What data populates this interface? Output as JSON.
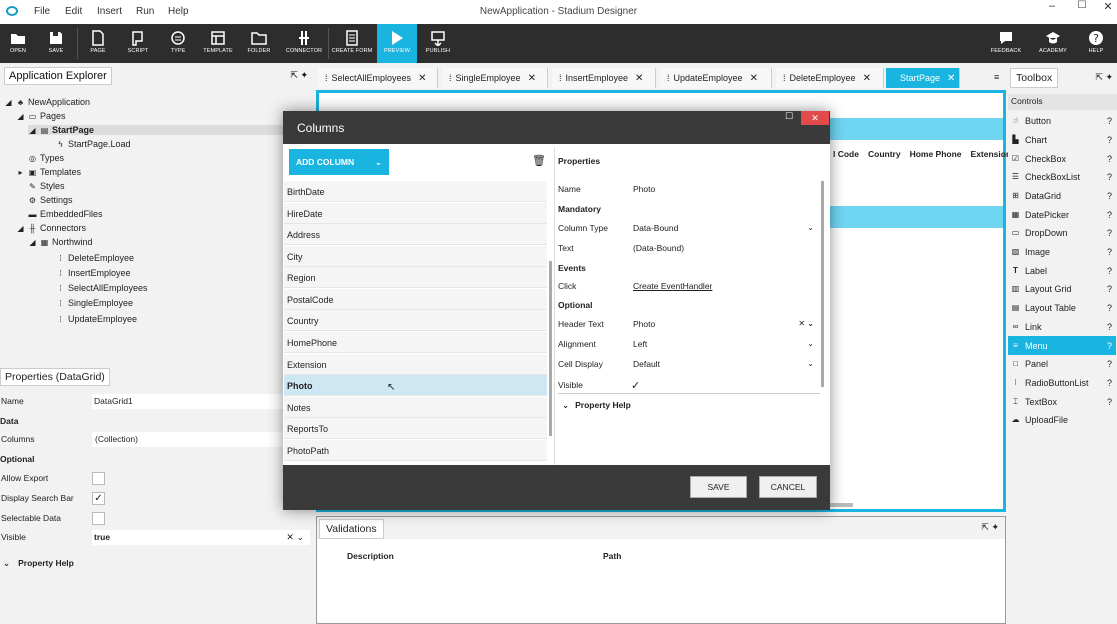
{
  "app": {
    "title": "NewApplication - Stadium Designer"
  },
  "menu": [
    "File",
    "Edit",
    "Insert",
    "Run",
    "Help"
  ],
  "toolbar": {
    "left": [
      "OPEN",
      "SAVE",
      "PAGE",
      "SCRIPT",
      "TYPE",
      "TEMPLATE",
      "FOLDER",
      "CONNECTOR",
      "CREATE FORM",
      "PREVIEW",
      "PUBLISH"
    ],
    "right": [
      "FEEDBACK",
      "ACADEMY",
      "HELP"
    ]
  },
  "explorer": {
    "title": "Application Explorer",
    "items": [
      "NewApplication",
      "Pages",
      "StartPage",
      "StartPage.Load",
      "Types",
      "Templates",
      "Styles",
      "Settings",
      "EmbeddedFiles",
      "Connectors",
      "Northwind",
      "DeleteEmployee",
      "InsertEmployee",
      "SelectAllEmployees",
      "SingleEmployee",
      "UpdateEmployee"
    ]
  },
  "properties": {
    "title": "Properties (DataGrid)",
    "name_label": "Name",
    "name_value": "DataGrid1",
    "data_section": "Data",
    "columns_label": "Columns",
    "columns_value": "(Collection)",
    "optional_section": "Optional",
    "allow_export": "Allow Export",
    "display_search_bar": "Display Search Bar",
    "selectable_data": "Selectable Data",
    "visible_label": "Visible",
    "visible_value": "true",
    "help": "Property Help"
  },
  "tabs": [
    "SelectAllEmployees",
    "SingleEmployee",
    "InsertEmployee",
    "UpdateEmployee",
    "DeleteEmployee",
    "StartPage"
  ],
  "grid_headers": [
    "l Code",
    "Country",
    "Home Phone",
    "Extensior"
  ],
  "toolbox": {
    "title": "Toolbox",
    "section": "Controls",
    "items": [
      "Button",
      "Chart",
      "CheckBox",
      "CheckBoxList",
      "DataGrid",
      "DatePicker",
      "DropDown",
      "Image",
      "Label",
      "Layout Grid",
      "Layout Table",
      "Link",
      "Menu",
      "Panel",
      "RadioButtonList",
      "TextBox",
      "UploadFile"
    ],
    "help": "?"
  },
  "dialog": {
    "title": "Columns",
    "add_column": "ADD COLUMN",
    "columns": [
      "BirthDate",
      "HireDate",
      "Address",
      "City",
      "Region",
      "PostalCode",
      "Country",
      "HomePhone",
      "Extension",
      "Photo",
      "Notes",
      "ReportsTo",
      "PhotoPath"
    ],
    "props_title": "Properties",
    "name_label": "Name",
    "name_value": "Photo",
    "mandatory": "Mandatory",
    "coltype_label": "Column Type",
    "coltype_value": "Data-Bound",
    "text_label": "Text",
    "text_value": "(Data-Bound)",
    "events": "Events",
    "click_label": "Click",
    "click_value": "Create EventHandler",
    "optional": "Optional",
    "header_label": "Header Text",
    "header_value": "Photo",
    "align_label": "Alignment",
    "align_value": "Left",
    "cell_label": "Cell Display",
    "cell_value": "Default",
    "visible_label": "Visible",
    "help": "Property Help",
    "save": "SAVE",
    "cancel": "CANCEL"
  },
  "validations": {
    "title": "Validations",
    "col_description": "Description",
    "col_path": "Path"
  },
  "colors": {
    "accent": "#1ab4e0",
    "toolbar": "#2d2d2d",
    "dialog_header": "#3a3a3a",
    "close": "#e24b4b"
  }
}
